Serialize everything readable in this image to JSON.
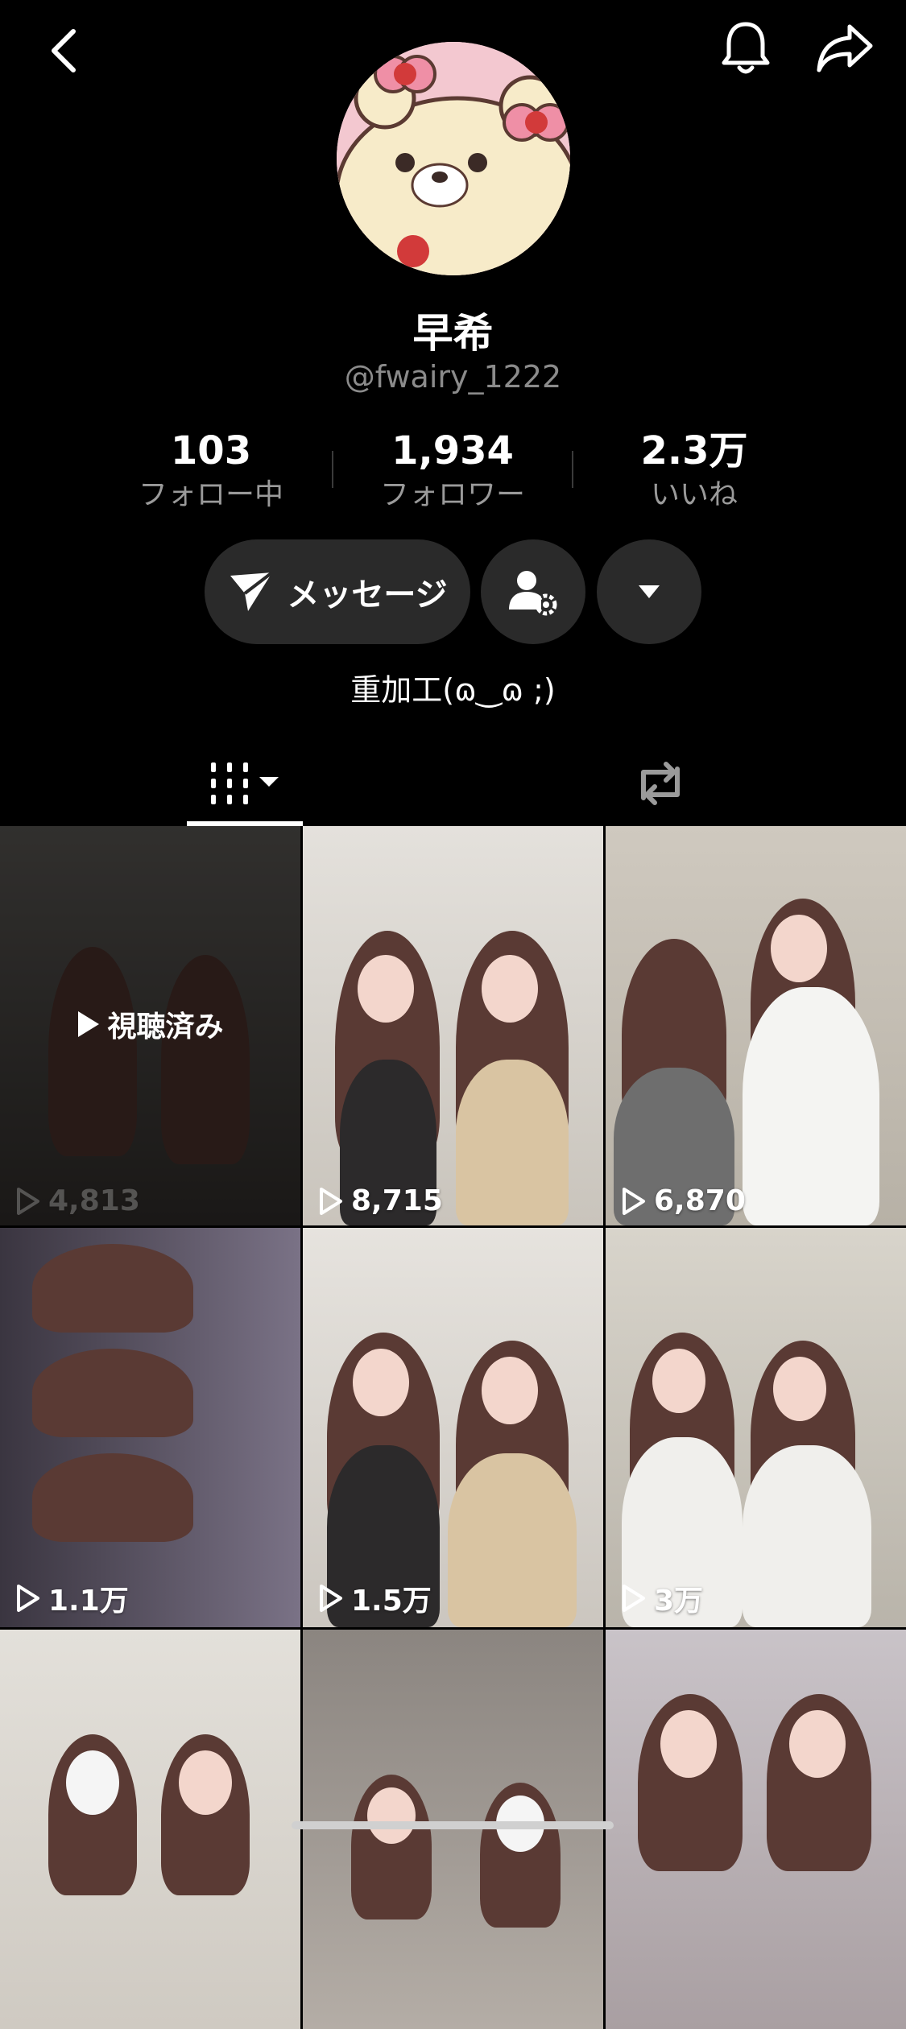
{
  "profile": {
    "name": "早希",
    "handle": "@fwairy_1222",
    "bio": "重加工(ɷ‿ɷ ;)"
  },
  "stats": [
    {
      "value": "103",
      "label": "フォロー中"
    },
    {
      "value": "1,934",
      "label": "フォロワー"
    },
    {
      "value": "2.3万",
      "label": "いいね"
    }
  ],
  "actions": {
    "message_label": "メッセージ"
  },
  "icons": {
    "back": "chevron-left-icon",
    "bell": "bell-icon",
    "share": "share-icon",
    "friend_settings": "person-gear-icon",
    "more": "caret-down-icon",
    "videos_tab": "grid-icon",
    "reposts_tab": "repost-icon"
  },
  "videos": [
    {
      "views": "4,813",
      "watched": true,
      "watched_label": "視聴済み"
    },
    {
      "views": "8,715",
      "watched": false
    },
    {
      "views": "6,870",
      "watched": false
    },
    {
      "views": "1.1万",
      "watched": false
    },
    {
      "views": "1.5万",
      "watched": false
    },
    {
      "views": "3万",
      "watched": false
    },
    {
      "views": "",
      "watched": false
    },
    {
      "views": "",
      "watched": false
    },
    {
      "views": "",
      "watched": false
    }
  ]
}
